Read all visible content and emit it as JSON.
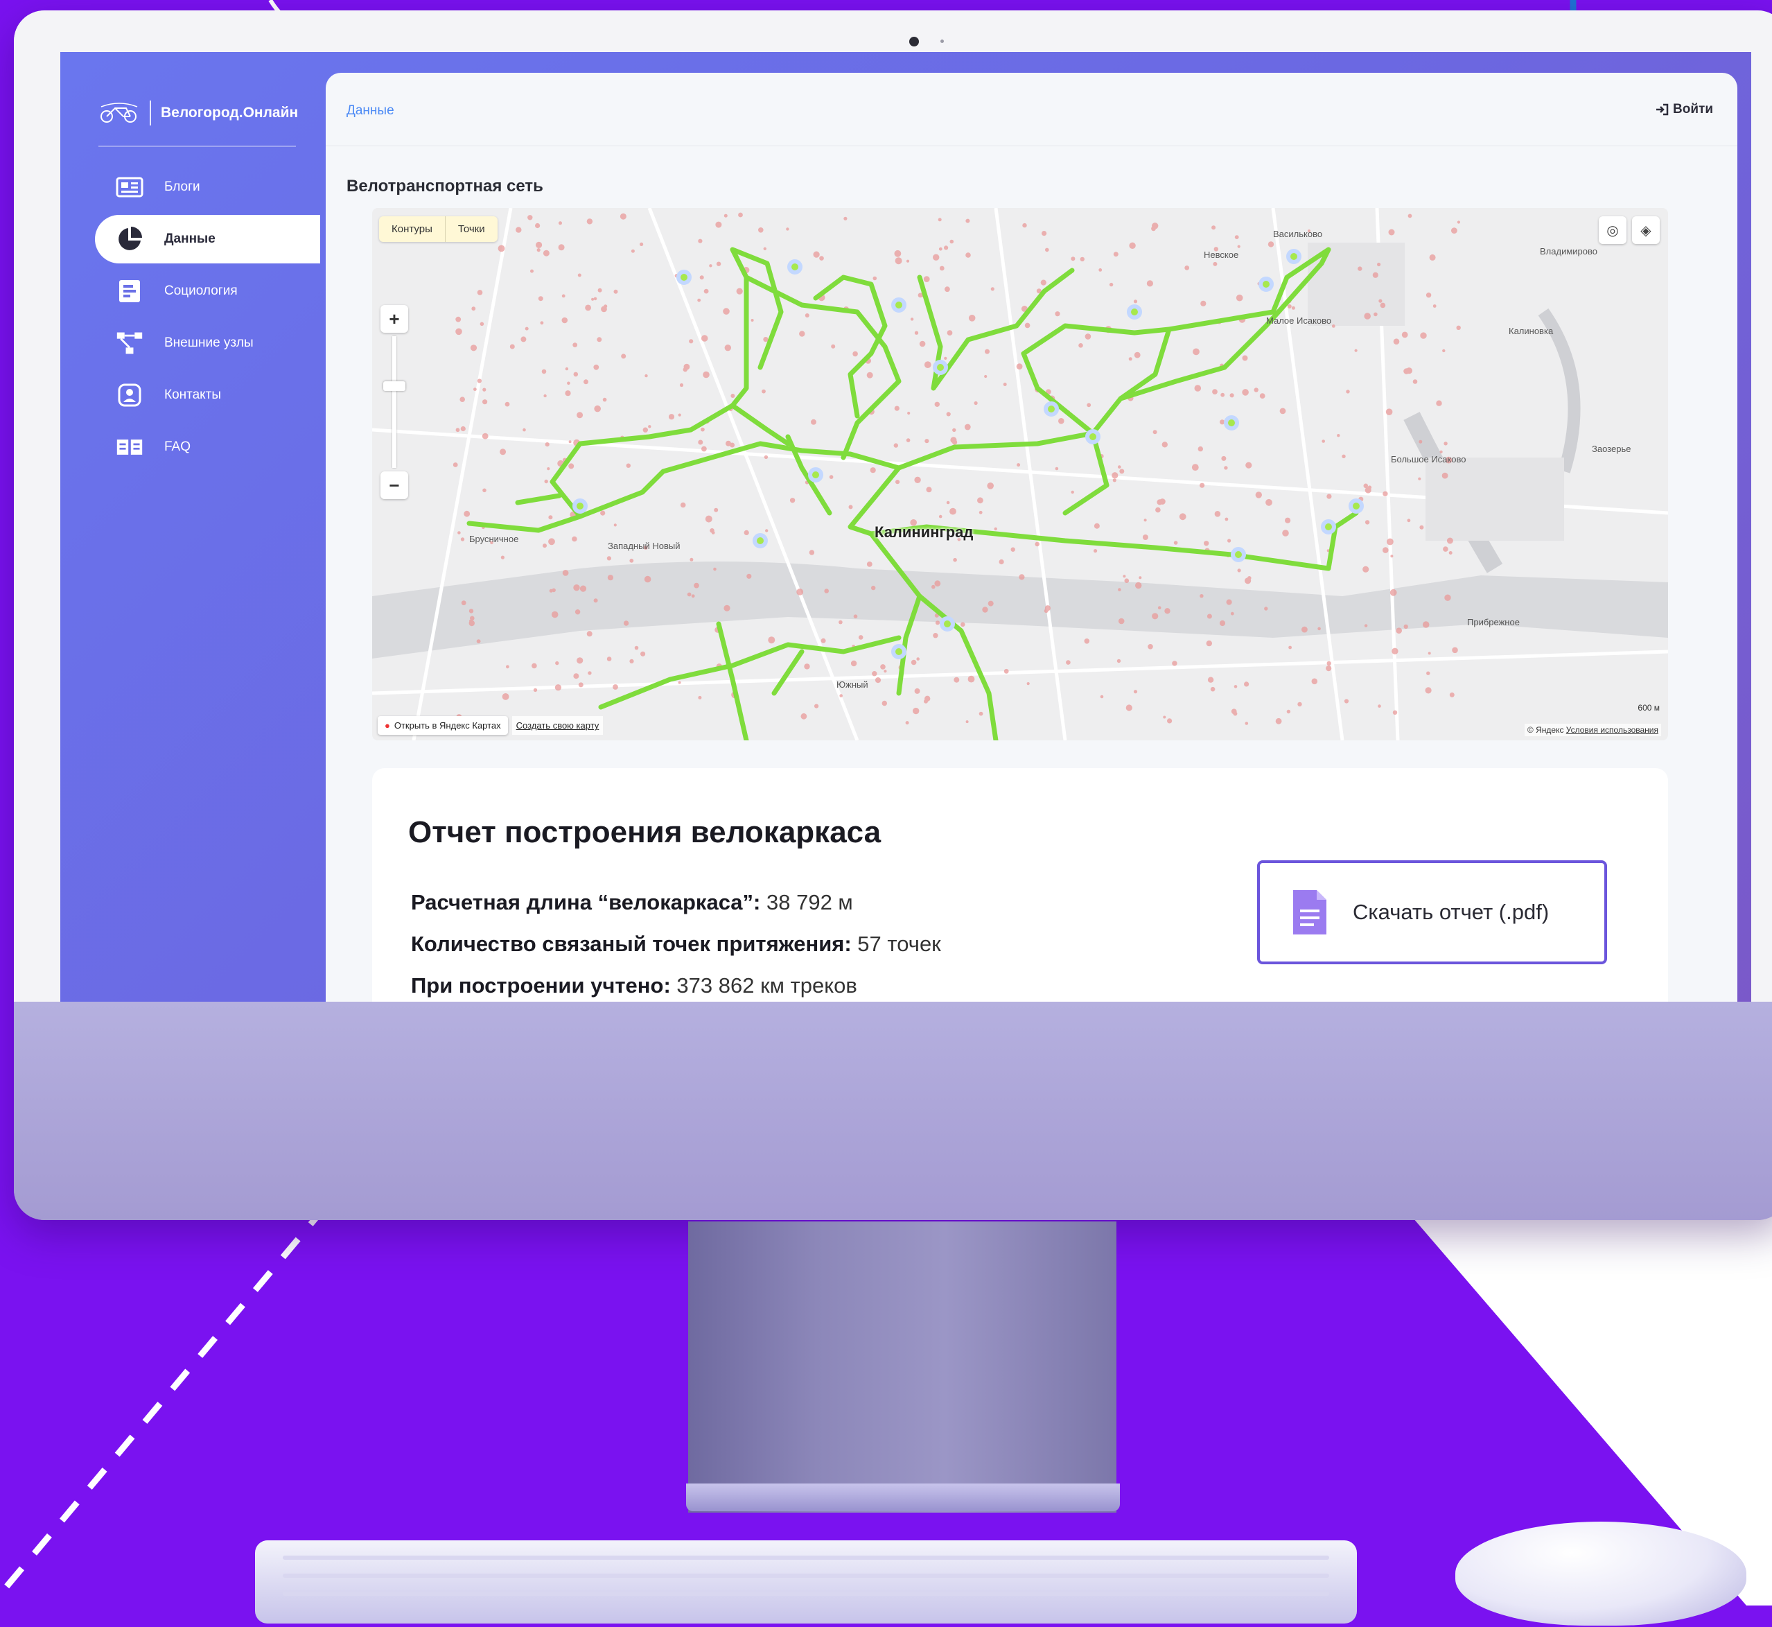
{
  "app": {
    "title": "Велогород.Онлайн"
  },
  "sidebar": {
    "items": [
      {
        "label": "Блоги",
        "icon": "newspaper-icon",
        "active": false
      },
      {
        "label": "Данные",
        "icon": "pie-chart-icon",
        "active": true
      },
      {
        "label": "Социология",
        "icon": "survey-icon",
        "active": false
      },
      {
        "label": "Внешние узлы",
        "icon": "network-nodes-icon",
        "active": false
      },
      {
        "label": "Контакты",
        "icon": "contacts-icon",
        "active": false
      },
      {
        "label": "FAQ",
        "icon": "book-icon",
        "active": false
      }
    ]
  },
  "header": {
    "breadcrumb": "Данные",
    "login_label": "Войти"
  },
  "main": {
    "section_title": "Велотранспортная сеть",
    "map": {
      "tabs": [
        "Контуры",
        "Точки"
      ],
      "city_label": "Калининград",
      "open_in_maps": "Открыть в Яндекс Картах",
      "create_map": "Создать свою карту",
      "copyright": "© Яндекс",
      "terms": "Условия использования",
      "scale": "600 м",
      "place_labels": [
        "Васильково",
        "Невское",
        "Малое Исаково",
        "Большое Исаково",
        "Заозерье",
        "Прибрежное",
        "Калиновка",
        "Владимирово",
        "Брусничное",
        "Западный Новый",
        "Южный"
      ]
    },
    "report": {
      "title": "Отчет построения велокаркаса",
      "lines": [
        {
          "label": "Расчетная длина “велокаркаса”:",
          "value": " 38 792 м"
        },
        {
          "label": "Количество связаный точек притяжения:",
          "value": " 57 точек"
        },
        {
          "label": "При построении учтено:",
          "value": " 373 862 км треков"
        }
      ],
      "download_label": "Скачать отчет (.pdf)"
    }
  },
  "colors": {
    "brand_purple": "#7a12f0",
    "sidebar_gradient_start": "#6a76ee",
    "active_nav_bg": "#ffffff",
    "route_green": "#7fdc3c",
    "breadcrumb_blue": "#4d8bf5",
    "download_border": "#6b55dc"
  }
}
